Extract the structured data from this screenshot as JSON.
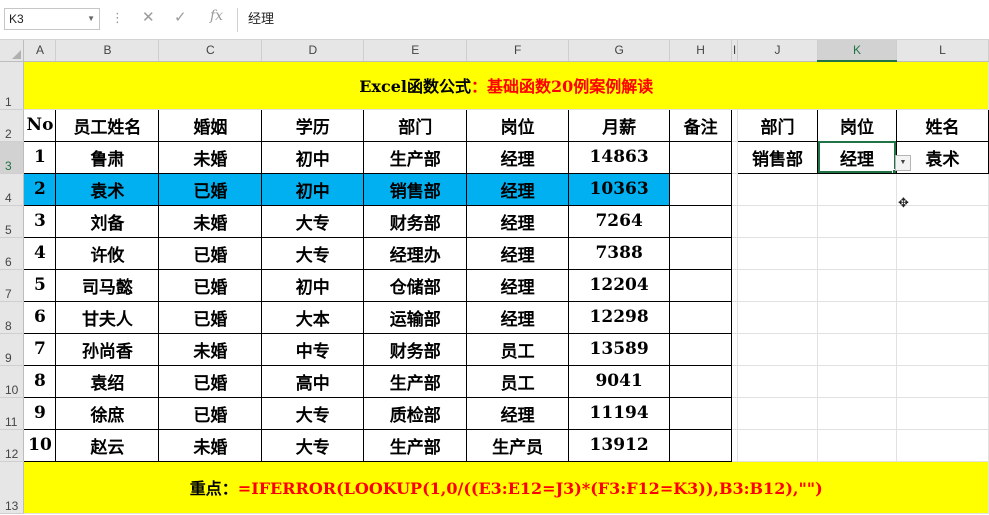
{
  "formula_bar": {
    "name_box": "K3",
    "cancel_icon": "✕",
    "confirm_icon": "✓",
    "fx_label": "fx",
    "content": "经理"
  },
  "columns": [
    "A",
    "B",
    "C",
    "D",
    "E",
    "F",
    "G",
    "H",
    "I",
    "J",
    "K",
    "L"
  ],
  "row_numbers": [
    "1",
    "2",
    "3",
    "4",
    "5",
    "6",
    "7",
    "8",
    "9",
    "10",
    "11",
    "12",
    "13"
  ],
  "title": {
    "black": "Excel函数公式",
    "red": "基础函数20例案例解读"
  },
  "table": {
    "headers": [
      "No",
      "员工姓名",
      "婚姻",
      "学历",
      "部门",
      "岗位",
      "月薪",
      "备注"
    ],
    "rows": [
      [
        "1",
        "鲁肃",
        "未婚",
        "初中",
        "生产部",
        "经理",
        "14863",
        ""
      ],
      [
        "2",
        "袁术",
        "已婚",
        "初中",
        "销售部",
        "经理",
        "10363",
        ""
      ],
      [
        "3",
        "刘备",
        "未婚",
        "大专",
        "财务部",
        "经理",
        "7264",
        ""
      ],
      [
        "4",
        "许攸",
        "已婚",
        "大专",
        "经理办",
        "经理",
        "7388",
        ""
      ],
      [
        "5",
        "司马懿",
        "已婚",
        "初中",
        "仓储部",
        "经理",
        "12204",
        ""
      ],
      [
        "6",
        "甘夫人",
        "已婚",
        "大本",
        "运输部",
        "经理",
        "12298",
        ""
      ],
      [
        "7",
        "孙尚香",
        "未婚",
        "中专",
        "财务部",
        "员工",
        "13589",
        ""
      ],
      [
        "8",
        "袁绍",
        "已婚",
        "高中",
        "生产部",
        "员工",
        "9041",
        ""
      ],
      [
        "9",
        "徐庶",
        "已婚",
        "大专",
        "质检部",
        "经理",
        "11194",
        ""
      ],
      [
        "10",
        "赵云",
        "未婚",
        "大专",
        "生产部",
        "生产员",
        "13912",
        ""
      ]
    ]
  },
  "lookup": {
    "headers": [
      "部门",
      "岗位",
      "姓名"
    ],
    "values": [
      "销售部",
      "经理",
      "袁术"
    ]
  },
  "footer": {
    "black": "重点：",
    "red": "=IFERROR(LOOKUP(1,0/((E3:E12=J3)*(F3:F12=K3)),B3:B12),\"\")"
  },
  "colors": {
    "highlight_row": "#00b0f0",
    "banner": "#ffff00",
    "red_text": "#ff0000",
    "selection": "#217346"
  }
}
